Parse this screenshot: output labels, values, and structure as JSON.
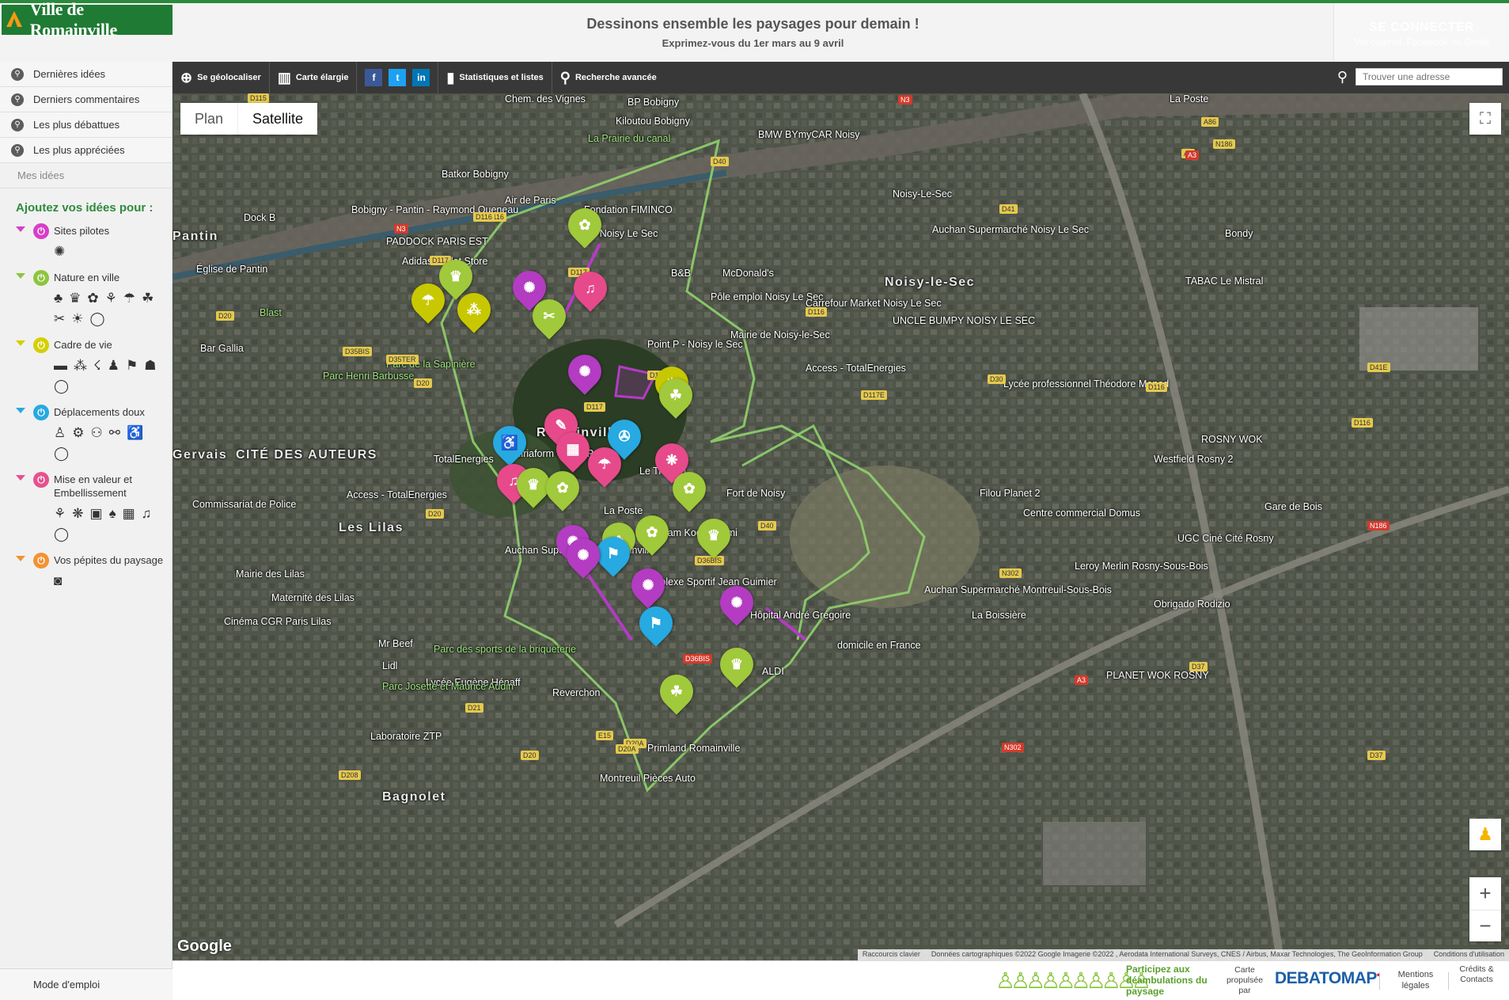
{
  "header": {
    "logo_text": "Ville de Romainville",
    "slogan_title": "Dessinons ensemble les paysages pour demain !",
    "slogan_subtitle": "Exprimez-vous du 1er mars au 9 avril",
    "login_title": "SE CONNECTER",
    "login_subtitle": "Via courriel, Facebook ou Gmail"
  },
  "sidebar": {
    "links": [
      {
        "label": "Dernières idées"
      },
      {
        "label": "Derniers commentaires"
      },
      {
        "label": "Les plus débattues"
      },
      {
        "label": "Les plus appréciées"
      }
    ],
    "my_ideas": "Mes idées",
    "add_title": "Ajoutez vos idées pour :",
    "categories": [
      {
        "name": "Sites pilotes",
        "color": "#d63fc9",
        "icons": [
          "sparkle-icon"
        ]
      },
      {
        "name": "Nature en ville",
        "color": "#8cc63f",
        "icons": [
          "tree-icon",
          "grass-icon",
          "planter-icon",
          "potted-plant-icon",
          "watering-icon",
          "hand-plant-icon",
          "shovel-icon",
          "sun-icon",
          "comment-icon"
        ]
      },
      {
        "name": "Cadre de vie",
        "color": "#d4d000",
        "icons": [
          "bench-icon",
          "fountain-icon",
          "lamp-icon",
          "playground-icon",
          "sport-icon",
          "kiosk-icon",
          "comment-icon"
        ]
      },
      {
        "name": "Déplacements doux",
        "color": "#27a9e1",
        "icons": [
          "pedestrian-icon",
          "bike-icon",
          "bike-parking-icon",
          "shared-path-icon",
          "wheelchair-icon",
          "comment-icon"
        ]
      },
      {
        "name": "Mise en valeur et Embellissement",
        "color": "#e8508f",
        "icons": [
          "flower-icon",
          "megaphone-icon",
          "fresco-icon",
          "tree-planter-icon",
          "market-icon",
          "music-icon",
          "comment-icon"
        ]
      },
      {
        "name": "Vos pépites du paysage",
        "color": "#f39233",
        "icons": [
          "camera-icon"
        ]
      }
    ],
    "mode_emploi": "Mode d'emploi"
  },
  "toolbar": {
    "geolocate": "Se géolocaliser",
    "wide_map": "Carte élargie",
    "social": [
      "f",
      "t",
      "in"
    ],
    "stats": "Statistiques et listes",
    "advanced_search": "Recherche avancée",
    "address_placeholder": "Trouver une adresse"
  },
  "map": {
    "type_plan": "Plan",
    "type_satellite": "Satellite",
    "google": "Google",
    "attribution": [
      "Raccourcis clavier",
      "Données cartographiques ©2022 Google Imagerie ©2022 , Aerodata International Surveys, CNES / Airbus, Maxar Technologies, The GeoInformation Group",
      "Conditions d'utilisation"
    ],
    "places": [
      {
        "text": "Chem. des Vignes",
        "cls": ""
      },
      {
        "text": "BP Bobigny",
        "cls": ""
      },
      {
        "text": "Kiloutou Bobigny",
        "cls": ""
      },
      {
        "text": "La Prairie du canal",
        "cls": "green"
      },
      {
        "text": "BMW BYmyCAR Noisy",
        "cls": ""
      },
      {
        "text": "Batkor Bobigny",
        "cls": ""
      },
      {
        "text": "Air de Paris",
        "cls": ""
      },
      {
        "text": "Fondation FIMINCO",
        "cls": ""
      },
      {
        "text": "Dock B",
        "cls": ""
      },
      {
        "text": "Bobigny - Pantin - Raymond Queneau",
        "cls": ""
      },
      {
        "text": "Pantin",
        "cls": "big"
      },
      {
        "text": "PADDOCK PARIS EST",
        "cls": ""
      },
      {
        "text": "Place Noisy Le Sec",
        "cls": ""
      },
      {
        "text": "Adidas Outlet Store",
        "cls": ""
      },
      {
        "text": "Église de Pantin",
        "cls": ""
      },
      {
        "text": "B&B",
        "cls": ""
      },
      {
        "text": "McDonald's",
        "cls": ""
      },
      {
        "text": "Pôle emploi Noisy Le Sec",
        "cls": ""
      },
      {
        "text": "Carrefour Market Noisy Le Sec",
        "cls": ""
      },
      {
        "text": "UNCLE BUMPY NOISY LE SEC",
        "cls": ""
      },
      {
        "text": "Mairie de Noisy-le-Sec",
        "cls": ""
      },
      {
        "text": "Point P - Noisy le Sec",
        "cls": ""
      },
      {
        "text": "Access - TotalEnergies",
        "cls": ""
      },
      {
        "text": "Noisy-le-Sec",
        "cls": "big"
      },
      {
        "text": "Noisy-Le-Sec",
        "cls": ""
      },
      {
        "text": "Auchan Supermarché Noisy Le Sec",
        "cls": ""
      },
      {
        "text": "TABAC Le Mistral",
        "cls": ""
      },
      {
        "text": "Blast",
        "cls": "green"
      },
      {
        "text": "Bar Gallia",
        "cls": ""
      },
      {
        "text": "Parc de la Sapinière",
        "cls": "green"
      },
      {
        "text": "Parc Henri Barbusse",
        "cls": "green"
      },
      {
        "text": "Lycée professionnel Théodore Monod",
        "cls": ""
      },
      {
        "text": "Romainville",
        "cls": "big"
      },
      {
        "text": "Gervais",
        "cls": "big"
      },
      {
        "text": "CITÉ DES AUTEURS",
        "cls": "big"
      },
      {
        "text": "TotalEnergies",
        "cls": ""
      },
      {
        "text": "Miriaform Grand Paris",
        "cls": ""
      },
      {
        "text": "Le Trianon",
        "cls": ""
      },
      {
        "text": "Access - TotalEnergies",
        "cls": ""
      },
      {
        "text": "Fort de Noisy",
        "cls": ""
      },
      {
        "text": "Filou Planet 2",
        "cls": ""
      },
      {
        "text": "Centre commercial Domus",
        "cls": ""
      },
      {
        "text": "ROSNY WOK",
        "cls": ""
      },
      {
        "text": "Westfield Rosny 2",
        "cls": ""
      },
      {
        "text": "Commissariat de Police",
        "cls": ""
      },
      {
        "text": "Les Lilas",
        "cls": "big"
      },
      {
        "text": "La Poste",
        "cls": ""
      },
      {
        "text": "Rostam Kod Chalimi",
        "cls": ""
      },
      {
        "text": "UGC Ciné Cité Rosny",
        "cls": ""
      },
      {
        "text": "Auchan Supermarché Romainville",
        "cls": ""
      },
      {
        "text": "Leroy Merlin Rosny-Sous-Bois",
        "cls": ""
      },
      {
        "text": "Mairie des Lilas",
        "cls": ""
      },
      {
        "text": "Complexe Sportif Jean Guimier",
        "cls": ""
      },
      {
        "text": "Maternité des Lilas",
        "cls": ""
      },
      {
        "text": "Hôpital André Grégoire",
        "cls": ""
      },
      {
        "text": "Auchan Supermarché Montreuil-Sous-Bois",
        "cls": ""
      },
      {
        "text": "La Boissière",
        "cls": ""
      },
      {
        "text": "Obrigado Rodizio",
        "cls": ""
      },
      {
        "text": "Cinéma CGR Paris Lilas",
        "cls": ""
      },
      {
        "text": "Mr Beef",
        "cls": ""
      },
      {
        "text": "Parc des sports de la briqueterie",
        "cls": "green"
      },
      {
        "text": "domicile en France",
        "cls": ""
      },
      {
        "text": "Lidl",
        "cls": ""
      },
      {
        "text": "Lycée Eugène Hénaff",
        "cls": ""
      },
      {
        "text": "ALDI",
        "cls": ""
      },
      {
        "text": "PLANET WOK ROSNY",
        "cls": ""
      },
      {
        "text": "Parc Josette et Maurice Audin",
        "cls": "green"
      },
      {
        "text": "Reverchon",
        "cls": ""
      },
      {
        "text": "Laboratoire ZTP",
        "cls": ""
      },
      {
        "text": "Primland Romainville",
        "cls": ""
      },
      {
        "text": "Montreuil Pièces Auto",
        "cls": ""
      },
      {
        "text": "La Poste",
        "cls": ""
      },
      {
        "text": "Bondy",
        "cls": ""
      },
      {
        "text": "Gare de Bois",
        "cls": ""
      },
      {
        "text": "Bagnolet",
        "cls": "big"
      }
    ],
    "roads": [
      "D115",
      "D116",
      "D40",
      "D117",
      "D116",
      "D117",
      "D20",
      "D35BIS",
      "D35TER",
      "D117",
      "D20",
      "D117E",
      "D116",
      "D30",
      "D116",
      "D41",
      "A86",
      "N186",
      "A3",
      "D41E",
      "D116",
      "D20",
      "D36BIS",
      "D40",
      "D117",
      "D37",
      "D20A",
      "D21",
      "D20",
      "D20A",
      "E15",
      "N302",
      "D37",
      "D208"
    ],
    "road_red": [
      "N3",
      "N3",
      "A3",
      "N186",
      "N302",
      "A3",
      "D36BIS"
    ],
    "pins": [
      {
        "color": "#a0c93b",
        "icon": "✿",
        "count": "1"
      },
      {
        "color": "#a0c93b",
        "icon": "♛",
        "count": "1"
      },
      {
        "color": "#c8c800",
        "icon": "☂",
        "count": "1"
      },
      {
        "color": "#c8c800",
        "icon": "⁂",
        "count": "1"
      },
      {
        "color": "#b33cc2",
        "icon": "✺",
        "count": "1"
      },
      {
        "color": "#e64a8b",
        "icon": "♫",
        "count": "1"
      },
      {
        "color": "#a0c93b",
        "icon": "✂",
        "count": "1"
      },
      {
        "color": "#b33cc2",
        "icon": "✺",
        "count": "1"
      },
      {
        "color": "#c8c800",
        "icon": "☀",
        "count": "1"
      },
      {
        "color": "#a0c93b",
        "icon": "☘",
        "count": "1"
      },
      {
        "color": "#e64a8b",
        "icon": "✎",
        "count": "1"
      },
      {
        "color": "#27a9e1",
        "icon": "♿",
        "count": "1"
      },
      {
        "color": "#27a9e1",
        "icon": "✇",
        "count": "1"
      },
      {
        "color": "#e64a8b",
        "icon": "▦",
        "count": "1"
      },
      {
        "color": "#e64a8b",
        "icon": "☂",
        "count": "1"
      },
      {
        "color": "#e64a8b",
        "icon": "❋",
        "count": "1"
      },
      {
        "color": "#e64a8b",
        "icon": "♫",
        "count": "1"
      },
      {
        "color": "#a0c93b",
        "icon": "♛",
        "count": "1"
      },
      {
        "color": "#a0c93b",
        "icon": "✿",
        "count": "1"
      },
      {
        "color": "#a0c93b",
        "icon": "✿",
        "count": "1"
      },
      {
        "color": "#b33cc2",
        "icon": "✺",
        "count": "1"
      },
      {
        "color": "#a0c93b",
        "icon": "♣",
        "count": "1"
      },
      {
        "color": "#27a9e1",
        "icon": "⚑",
        "count": "1"
      },
      {
        "color": "#a0c93b",
        "icon": "✿",
        "count": "1"
      },
      {
        "color": "#a0c93b",
        "icon": "♛",
        "count": "1"
      },
      {
        "color": "#b33cc2",
        "icon": "✺",
        "count": "1"
      },
      {
        "color": "#b33cc2",
        "icon": "✺",
        "count": "1"
      },
      {
        "color": "#27a9e1",
        "icon": "⚑",
        "count": "1"
      },
      {
        "color": "#b33cc2",
        "icon": "✺",
        "count": "1"
      },
      {
        "color": "#a0c93b",
        "icon": "♛",
        "count": "1"
      },
      {
        "color": "#a0c93b",
        "icon": "☘",
        "count": "1"
      }
    ]
  },
  "footer": {
    "participate": "Participez aux déambulations du paysage",
    "powered_by": "Carte propulsée par",
    "debatomap": "DEBATOMAP",
    "mentions": "Mentions légales",
    "credits": "Crédits & Contacts"
  }
}
